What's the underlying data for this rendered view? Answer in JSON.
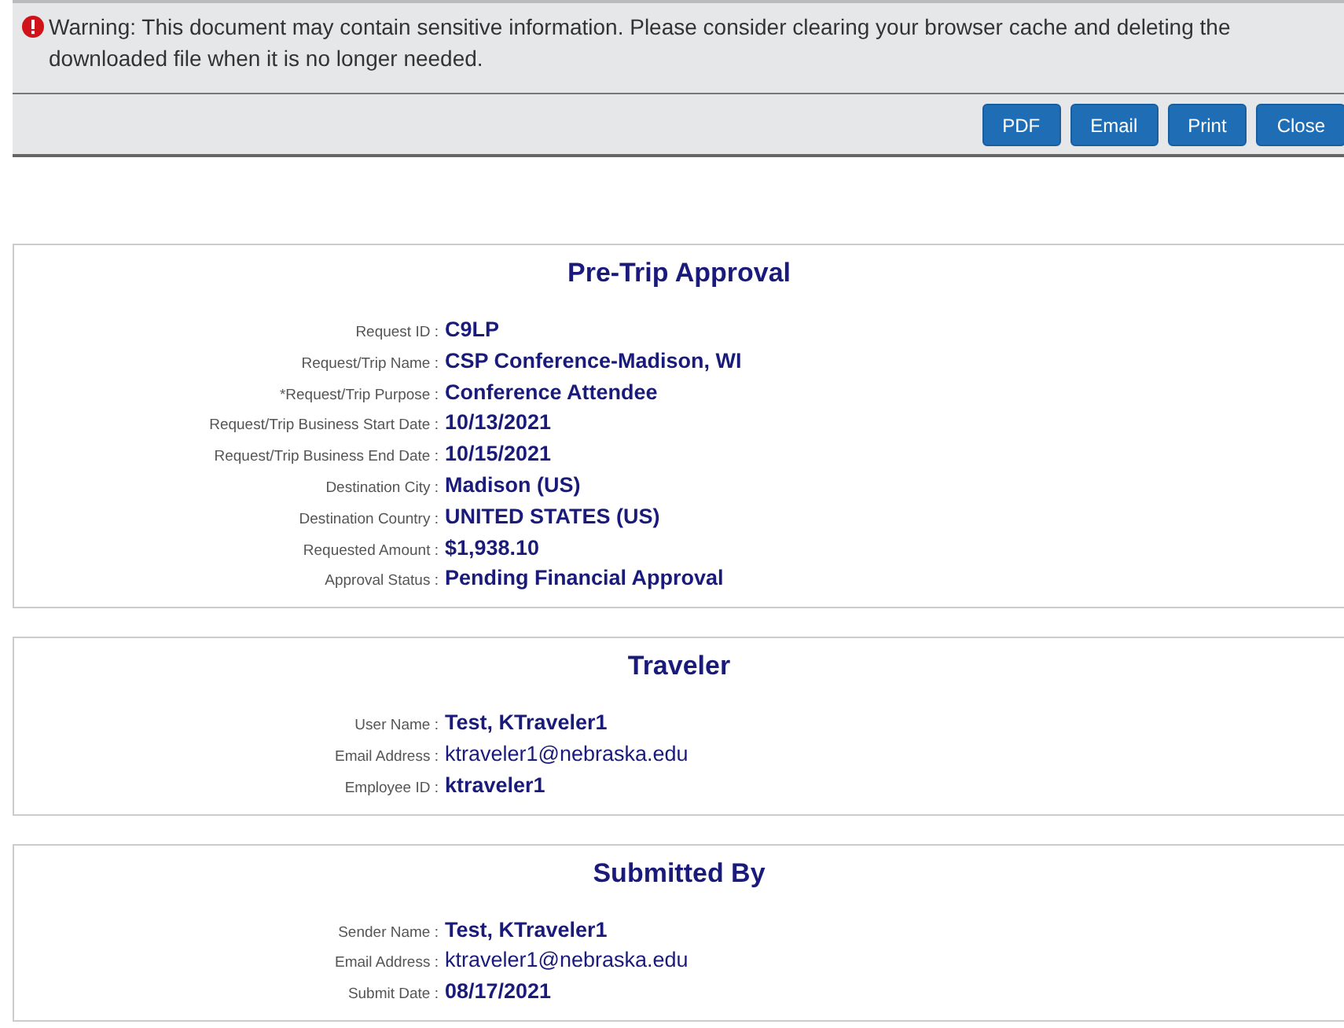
{
  "warning": {
    "text": "Warning: This document may contain sensitive information. Please consider clearing your browser cache and deleting the downloaded file when it is no longer needed."
  },
  "buttons": [
    "PDF",
    "Email",
    "Print",
    "Close"
  ],
  "sections": [
    {
      "title": "Pre-Trip Approval",
      "fields": [
        {
          "label": "Request ID :",
          "value": "C9LP",
          "bold": true
        },
        {
          "label": "Request/Trip Name :",
          "value": "CSP Conference-Madison, WI",
          "bold": true
        },
        {
          "label": "*Request/Trip Purpose :",
          "value": "Conference Attendee",
          "bold": true
        },
        {
          "label": "Request/Trip Business Start Date :",
          "value": "10/13/2021",
          "bold": true
        },
        {
          "label": "Request/Trip Business End Date :",
          "value": "10/15/2021",
          "bold": true
        },
        {
          "label": "Destination City :",
          "value": "Madison (US)",
          "bold": true
        },
        {
          "label": "Destination Country :",
          "value": "UNITED STATES (US)",
          "bold": true
        },
        {
          "label": "Requested Amount :",
          "value": "$1,938.10",
          "bold": true
        },
        {
          "label": "Approval Status :",
          "value": "Pending Financial Approval",
          "bold": true
        }
      ]
    },
    {
      "title": "Traveler",
      "fields": [
        {
          "label": "User Name :",
          "value": "Test, KTraveler1",
          "bold": true
        },
        {
          "label": "Email Address :",
          "value": "ktraveler1@nebraska.edu",
          "bold": false
        },
        {
          "label": "Employee ID :",
          "value": "ktraveler1",
          "bold": true
        }
      ]
    },
    {
      "title": "Submitted By",
      "fields": [
        {
          "label": "Sender Name :",
          "value": "Test, KTraveler1",
          "bold": true
        },
        {
          "label": "Email Address :",
          "value": "ktraveler1@nebraska.edu",
          "bold": false
        },
        {
          "label": "Submit Date :",
          "value": "08/17/2021",
          "bold": true
        }
      ]
    }
  ]
}
